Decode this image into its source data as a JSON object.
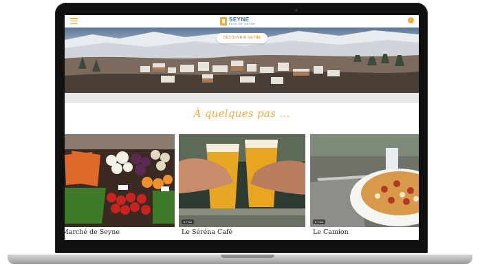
{
  "header": {
    "logo_title": "SEYNE",
    "logo_subtitle": "PAYS DE SEYNE",
    "info_glyph": "i",
    "menu_icon": "hamburger-icon",
    "info_icon": "info-icon"
  },
  "hero": {
    "button_label": "DÉCOUVRIR SEYNE"
  },
  "section": {
    "title": "À quelques pas ..."
  },
  "cards": [
    {
      "caption": "Marché de Seyne",
      "badge": ""
    },
    {
      "caption": "Le Séréna Café",
      "badge": "6.7 km"
    },
    {
      "caption": "Le Camion",
      "badge": "6.7 km"
    }
  ],
  "colors": {
    "accent": "#f2a93b",
    "brand_blue": "#2f6fb5",
    "bezel": "#101010"
  }
}
